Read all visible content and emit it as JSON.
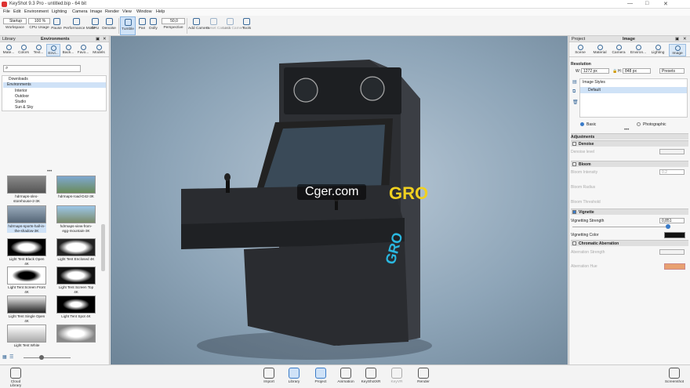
{
  "window": {
    "title": "KeyShot 9.3 Pro - untitled.bip - 64 bit",
    "minimize": "—",
    "maximize": "□",
    "close": "✕"
  },
  "menu": [
    "File",
    "Edit",
    "Environment",
    "Lighting",
    "Camera",
    "Image",
    "Render",
    "View",
    "Window",
    "Help"
  ],
  "toolbar": {
    "workspace_value": "Startup",
    "workspace_label": "Workspace",
    "cpu_value": "100 %",
    "cpu_label": "CPU Usage",
    "pause": "Pause",
    "performance": "Performance Mode",
    "gpu": "GPU",
    "denoise": "Denoise",
    "tumble": "Tumble",
    "pan": "Pan",
    "dolly": "Dolly",
    "fov_value": "50,0",
    "perspective": "Perspective",
    "add_camera": "Add Camera",
    "reset_camera": "Reset Camera",
    "lock_camera": "Lock Camera",
    "tools": "Tools"
  },
  "left": {
    "panel": "Library",
    "title": "Environments",
    "tabs": [
      "Mate...",
      "Colors",
      "Text...",
      "Envi...",
      "Back...",
      "Favo...",
      "Models"
    ],
    "tree": [
      "Downloads",
      "Environments",
      "Interior",
      "Outdoor",
      "Studio",
      "Sun & Sky"
    ],
    "thumbs": [
      "hdrmaps-oleo-storehouse-2-3K",
      "hdrmaps-road-D42-3K",
      "hdrmaps-sports-hall-in-the-shadow-3K",
      "hdrmaps-view-from-egg-mountain-3K",
      "Light Tent Black Open 4K",
      "Light Tent Enclosed 4K",
      "Light Tent Screen Front 4K",
      "Light Tent Screen Top 4K",
      "Light Tent Single Open 4K",
      "Light Tent Spot 4K",
      "Light Tent White",
      ""
    ]
  },
  "right": {
    "panel": "Project",
    "title": "Image",
    "tabs": [
      "Scene",
      "Material",
      "Camera",
      "Environ...",
      "Lighting",
      "Image"
    ],
    "resolution": "Resolution",
    "w_label": "W:",
    "w": "1272 px",
    "h_label": "H:",
    "h": "848 px",
    "presets": "Presets",
    "image_styles": "Image Styles",
    "style_default": "Default",
    "basic": "Basic",
    "photographic": "Photographic",
    "adjustments": "Adjustments",
    "denoise": "Denoise",
    "denoise_level": "Denoise level",
    "bloom": "Bloom",
    "bloom_intensity": "Bloom Intensity",
    "bloom_intensity_val": "0.2",
    "bloom_radius": "Bloom Radius",
    "bloom_threshold": "Bloom Threshold",
    "vignette": "Vignette",
    "vignette_strength": "Vignetting Strength",
    "vignette_strength_val": "0,851",
    "vignette_color": "Vignetting Color",
    "chromatic": "Chromatic Aberration",
    "aberration_strength": "Aberration Strength",
    "aberration_hue": "Aberration Hue"
  },
  "bottom": [
    "Cloud Library",
    "Import",
    "Library",
    "Project",
    "Animation",
    "KeyShotXR",
    "KeyVR",
    "Render",
    "Screenshot"
  ],
  "watermark": "Cger.com",
  "colors": {
    "accent": "#3a7bc8",
    "vignette": "#111111",
    "aberration": "#e8a070"
  }
}
